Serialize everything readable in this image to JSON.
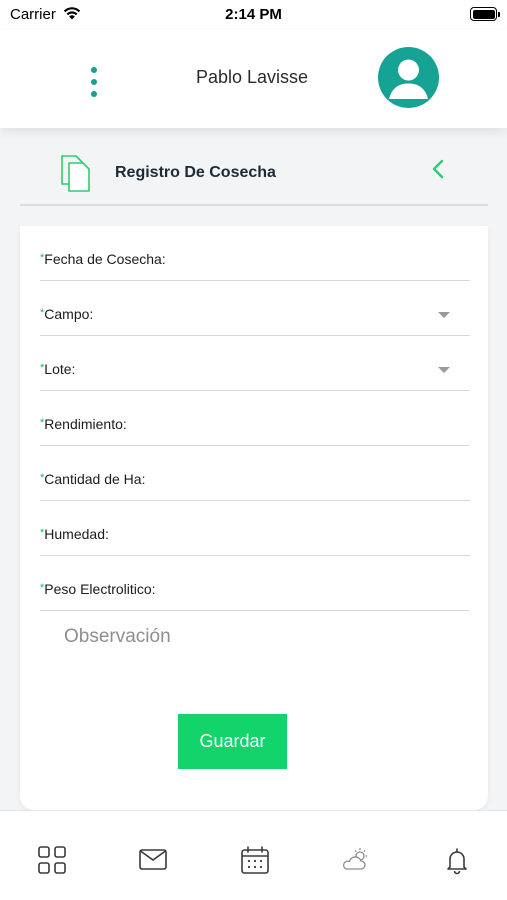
{
  "status_bar": {
    "carrier": "Carrier",
    "time": "2:14 PM"
  },
  "header": {
    "user_name": "Pablo Lavisse",
    "menu_icon": "more-vertical-icon",
    "avatar_icon": "user-avatar-icon"
  },
  "section": {
    "title": "Registro De Cosecha",
    "icon": "documents-icon",
    "back_icon": "chevron-left-icon"
  },
  "form": {
    "required_mark": "*",
    "fields": [
      {
        "label": "Fecha de Cosecha:",
        "type": "text"
      },
      {
        "label": "Campo:",
        "type": "select"
      },
      {
        "label": "Lote:",
        "type": "select"
      },
      {
        "label": "Rendimiento:",
        "type": "text"
      },
      {
        "label": "Cantidad de Ha:",
        "type": "text"
      },
      {
        "label": "Humedad:",
        "type": "text"
      },
      {
        "label": "Peso Electrolitico:",
        "type": "text"
      }
    ],
    "observation_placeholder": "Observación",
    "save_label": "Guardar"
  },
  "tab_bar": {
    "items": [
      "grid-icon",
      "mail-icon",
      "calendar-icon",
      "weather-icon",
      "bell-icon"
    ]
  },
  "colors": {
    "teal": "#16a394",
    "green_button": "#12d46b",
    "required_green": "#1fb855",
    "back_chevron": "#2ecc71",
    "background": "#f2f4f6"
  }
}
